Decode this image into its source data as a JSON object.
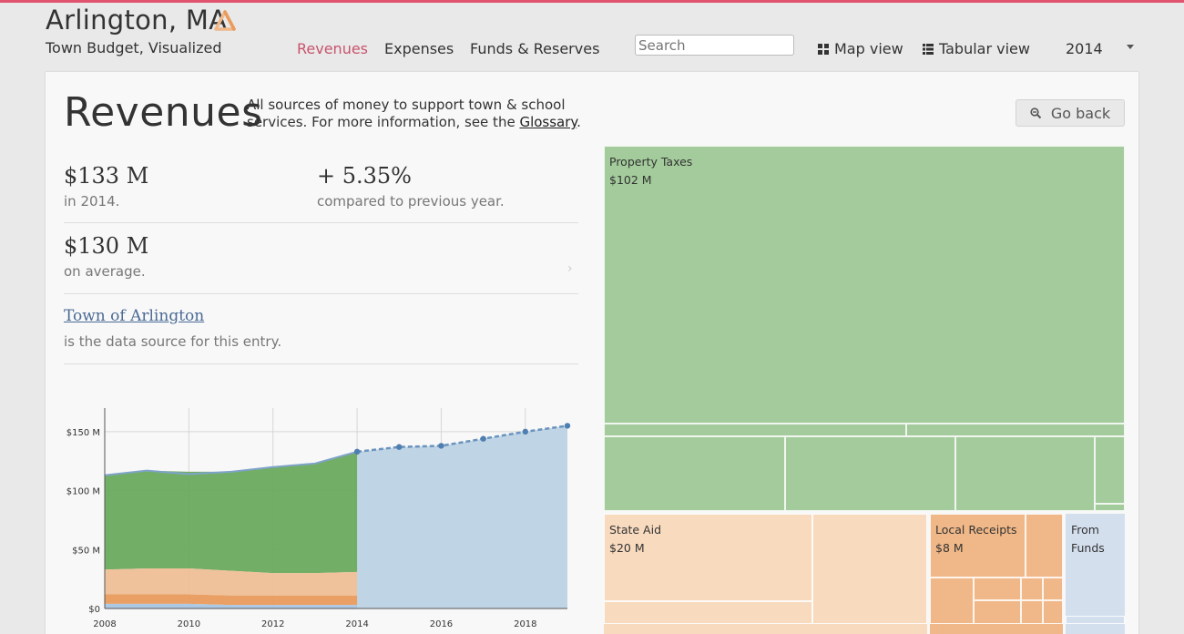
{
  "header": {
    "title": "Arlington, MA",
    "subtitle": "Town Budget, Visualized",
    "logo_icon": "triangle-logo-icon",
    "accent_color": "#e0546f"
  },
  "nav": {
    "items": [
      {
        "label": "Revenues",
        "active": true
      },
      {
        "label": "Expenses",
        "active": false
      },
      {
        "label": "Funds & Reserves",
        "active": false
      }
    ]
  },
  "search": {
    "placeholder": "Search",
    "value": ""
  },
  "views": {
    "map_label": "Map view",
    "map_icon": "grid-icon",
    "table_label": "Tabular view",
    "table_icon": "list-icon"
  },
  "year_select": {
    "value": "2014"
  },
  "page": {
    "title": "Revenues",
    "desc_before": "All sources of money to support town & school services. For more information, see the ",
    "desc_link": "Glossary",
    "desc_after": ".",
    "go_back_label": "Go back",
    "go_back_icon": "zoom-out-icon"
  },
  "stats": {
    "total_value": "$133 M",
    "total_caption": "in 2014.",
    "change_value": "+ 5.35%",
    "change_caption": "compared to previous year.",
    "avg_value": "$130 M",
    "avg_caption": "on average.",
    "source_link": "Town of Arlington",
    "source_caption": "is the data source for this entry."
  },
  "chart_data": {
    "type": "area",
    "x_ticks": [
      "2008",
      "2010",
      "2012",
      "2014",
      "2016",
      "2018"
    ],
    "y_ticks": [
      "$150 M",
      "$100 M",
      "$50 M",
      "$0"
    ],
    "xlim": [
      2008,
      2019
    ],
    "ylim": [
      0,
      170
    ],
    "actual_end_year": 2014,
    "series": [
      {
        "color": "#6aaa5e",
        "x": [
          2008,
          2009,
          2010,
          2011,
          2012,
          2013,
          2014
        ],
        "values": [
          80,
          83,
          82,
          84,
          90,
          93,
          102
        ]
      },
      {
        "color": "#eebf96",
        "x": [
          2008,
          2009,
          2010,
          2011,
          2012,
          2013,
          2014
        ],
        "values": [
          21,
          22,
          22,
          21,
          19,
          19,
          20
        ]
      },
      {
        "color": "#e99b5c",
        "x": [
          2008,
          2009,
          2010,
          2011,
          2012,
          2013,
          2014
        ],
        "values": [
          8,
          8,
          8,
          8,
          8,
          8,
          8
        ]
      },
      {
        "color": "#a9c5e0",
        "x": [
          2008,
          2009,
          2010,
          2011,
          2012,
          2013,
          2014
        ],
        "values": [
          4,
          4,
          4,
          3,
          3,
          3,
          3
        ]
      }
    ],
    "total_line": {
      "x": [
        2008,
        2009,
        2010,
        2011,
        2012,
        2013,
        2014,
        2015,
        2016,
        2017,
        2018,
        2019
      ],
      "values": [
        113,
        117,
        114,
        116,
        120,
        123,
        133,
        137,
        138,
        144,
        150,
        155
      ]
    }
  },
  "treemap": {
    "groups": [
      {
        "label": "Property Taxes",
        "value_label": "$102 M",
        "value": 102,
        "color": "#a3cb9b"
      },
      {
        "label": "State Aid",
        "value_label": "$20 M",
        "value": 20,
        "color": "#f8dbbf"
      },
      {
        "label": "Local Receipts",
        "value_label": "$8 M",
        "value": 8,
        "color": "#f0b888"
      },
      {
        "label": "From Funds",
        "value_label": "",
        "value": 3,
        "color": "#d4dfee"
      }
    ]
  }
}
